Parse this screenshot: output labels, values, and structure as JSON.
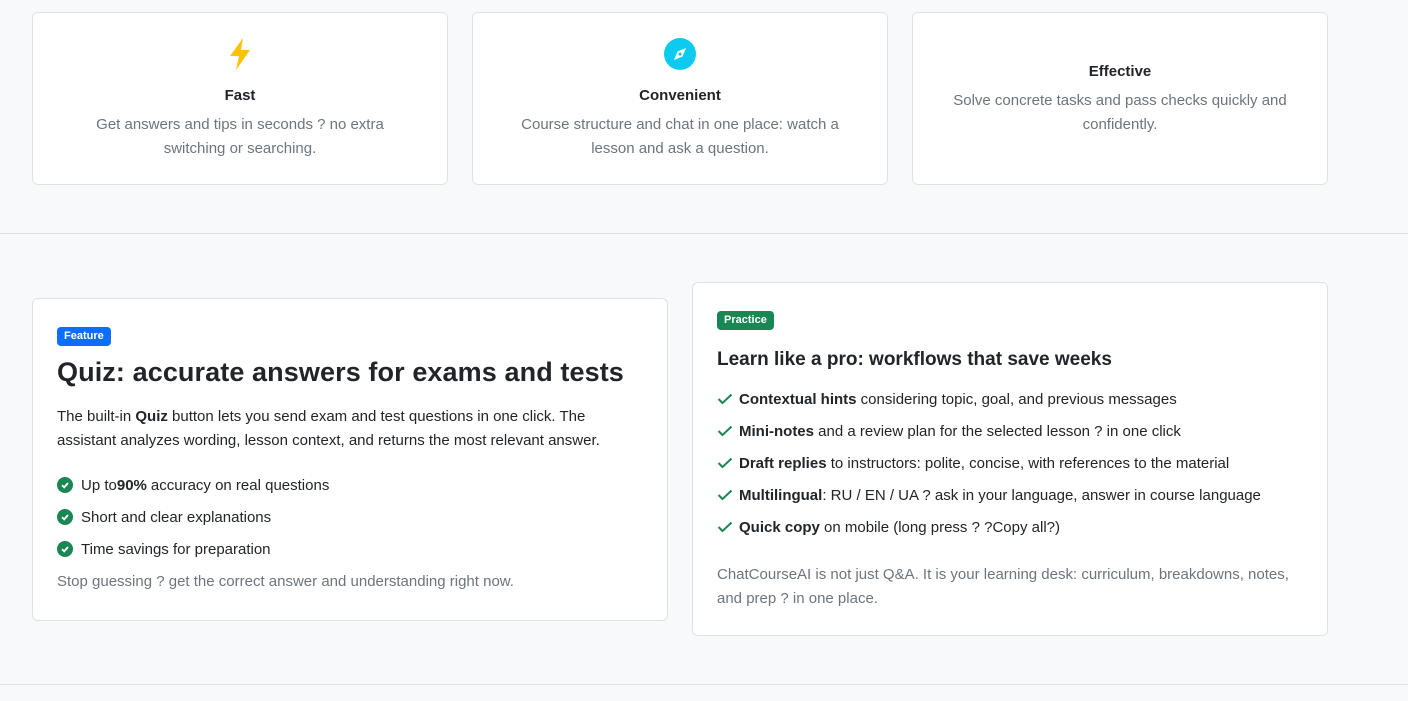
{
  "features": [
    {
      "icon": "lightning-icon",
      "title": "Fast",
      "text": "Get answers and tips in seconds ? no extra switching or searching."
    },
    {
      "icon": "compass-icon",
      "title": "Convenient",
      "text": "Course structure and chat in one place: watch a lesson and ask a question."
    },
    {
      "icon": "",
      "title": "Effective",
      "text": "Solve concrete tasks and pass checks quickly and confidently."
    }
  ],
  "quiz": {
    "badge": "Feature",
    "title": "Quiz: accurate answers for exams and tests",
    "desc_pre": "The built-in ",
    "desc_bold": "Quiz",
    "desc_post": " button lets you send exam and test questions in one click. The assistant analyzes wording, lesson context, and returns the most relevant answer.",
    "items": [
      {
        "pre": "Up to ",
        "bold": "90%",
        "post": " accuracy on real questions"
      },
      {
        "pre": "Short and clear explanations",
        "bold": "",
        "post": ""
      },
      {
        "pre": "Time savings for preparation",
        "bold": "",
        "post": ""
      }
    ],
    "footer": "Stop guessing ? get the correct answer and understanding right now."
  },
  "practice": {
    "badge": "Practice",
    "title": "Learn like a pro: workflows that save weeks",
    "items": [
      {
        "bold": "Contextual hints",
        "text": " considering topic, goal, and previous messages"
      },
      {
        "bold": "Mini-notes",
        "text": " and a review plan for the selected lesson ? in one click"
      },
      {
        "bold": "Draft replies",
        "text": " to instructors: polite, concise, with references to the material"
      },
      {
        "bold": "Multilingual",
        "text": ": RU / EN / UA ? ask in your language, answer in course language"
      },
      {
        "bold": "Quick copy",
        "text": " on mobile (long press ? ?Copy all?)"
      }
    ],
    "footer": "ChatCourseAI is not just Q&A. It is your learning desk: curriculum, breakdowns, notes, and prep ? in one place."
  },
  "colors": {
    "primary": "#0d6efd",
    "success": "#198754",
    "lightning": "#ffc107",
    "compass": "#0dcaf0",
    "muted": "#6c757d",
    "border": "#dee2e6",
    "background": "#f8f9fa"
  }
}
